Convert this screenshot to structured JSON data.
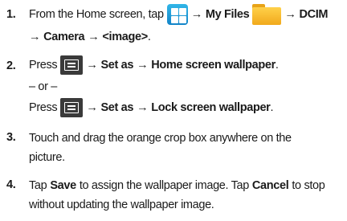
{
  "steps": [
    {
      "number": "1.",
      "l1": {
        "t1": "From the Home screen, tap",
        "arrow1": "→",
        "t2": "My Files",
        "arrow2": "→",
        "t3": "DCIM"
      },
      "l2": {
        "arrow1": "→",
        "t1": "Camera",
        "arrow2": "→",
        "t2": "<image>",
        "t3": "."
      }
    },
    {
      "number": "2.",
      "l1": {
        "t1": "Press",
        "arrow": "→",
        "t2": "Set as",
        "arrow2": "→",
        "t3": "Home screen wallpaper",
        "t4": "."
      },
      "or": "– or –",
      "l3": {
        "t1": "Press",
        "arrow": "→",
        "t2": "Set as",
        "arrow2": "→",
        "t3": "Lock screen wallpaper",
        "t4": "."
      }
    },
    {
      "number": "3.",
      "l1": "Touch and drag the orange crop box anywhere on the",
      "l2": "picture."
    },
    {
      "number": "4.",
      "l1": {
        "t1": "Tap",
        "t2": "Save",
        "t3": "to assign the wallpaper image. Tap",
        "t4": "Cancel",
        "t5": "to stop"
      },
      "l2": "without updating the wallpaper image."
    }
  ],
  "icons": {
    "apps": "apps-grid-icon",
    "folder": "folder-icon",
    "menu": "menu-key-icon"
  }
}
